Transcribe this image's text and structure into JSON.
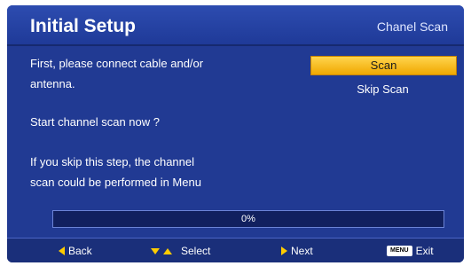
{
  "header": {
    "title": "Initial Setup",
    "subtitle": "Chanel Scan"
  },
  "body": {
    "line1": "First, please connect cable and/or",
    "line2": "antenna.",
    "line3": "Start channel scan now ?",
    "line4": "If you skip this step, the channel",
    "line5": "scan could be performed in Menu"
  },
  "actions": {
    "scan_label": "Scan",
    "skip_label": "Skip Scan"
  },
  "progress": {
    "label": "0%",
    "value": 0
  },
  "footer": {
    "back_label": "Back",
    "select_label": "Select",
    "next_label": "Next",
    "menu_key_label": "MENU",
    "exit_label": "Exit"
  },
  "colors": {
    "background": "#213a93",
    "highlight": "#f0a800",
    "arrow": "#ffcc00"
  },
  "icons": {
    "back": "triangle-left-icon",
    "select_down": "triangle-down-icon",
    "select_up": "triangle-up-icon",
    "next": "triangle-right-icon"
  }
}
